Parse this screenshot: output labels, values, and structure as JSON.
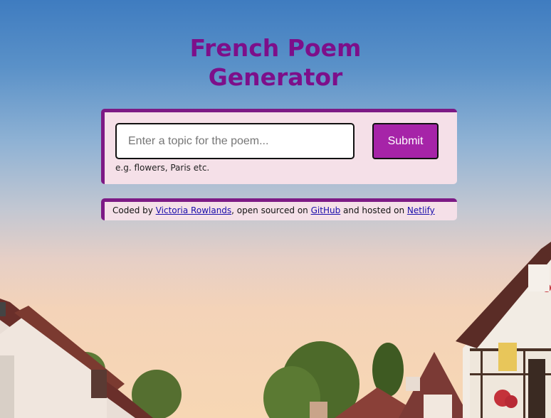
{
  "header": {
    "title_line1": "French Poem",
    "title_line2": "Generator"
  },
  "form": {
    "input_placeholder": "Enter a topic for the poem...",
    "input_value": "",
    "submit_label": "Submit",
    "hint": "e.g. flowers, Paris etc."
  },
  "footer": {
    "coded_by": "Coded by ",
    "author_link": "Victoria Rowlands",
    "open_sourced": ", open sourced on ",
    "github_link": "GitHub",
    "hosted_on": " and hosted on ",
    "netlify_link": "Netlify"
  },
  "colors": {
    "accent_purple": "#7d0f8a",
    "button_purple": "#a624a8",
    "card_background": "#f5e0e8",
    "link_blue": "#1a0dab"
  }
}
